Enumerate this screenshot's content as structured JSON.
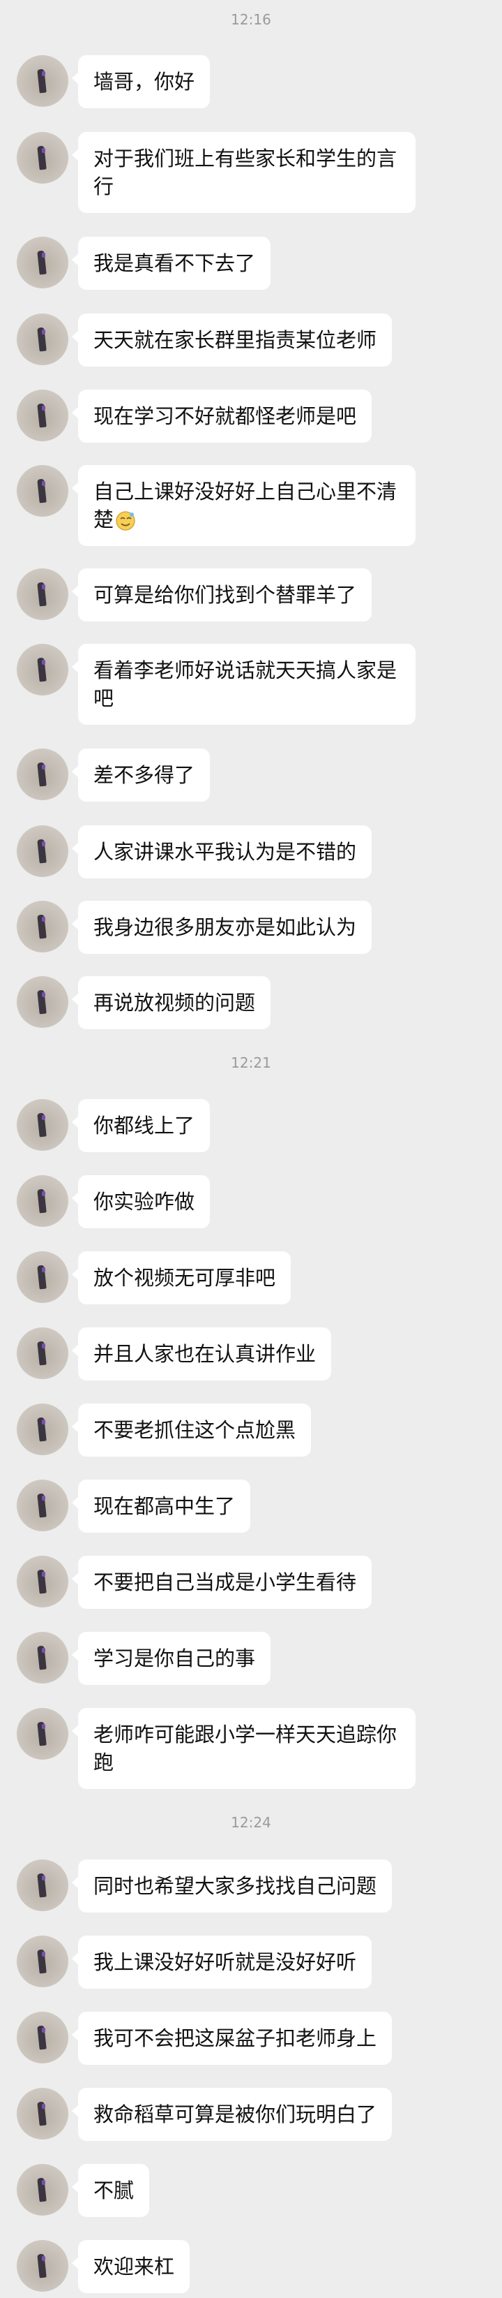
{
  "times": [
    "12:16",
    "12:21",
    "12:24"
  ],
  "messages": [
    {
      "text": "墙哥，你好"
    },
    {
      "text": "对于我们班上有些家长和学生的言行"
    },
    {
      "text": "我是真看不下去了"
    },
    {
      "text": "天天就在家长群里指责某位老师"
    },
    {
      "text": "现在学习不好就都怪老师是吧"
    },
    {
      "text": "自己上课好没好好上自己心里不清楚"
    },
    {
      "text": "可算是给你们找到个替罪羊了"
    },
    {
      "text": "看着李老师好说话就天天搞人家是吧"
    },
    {
      "text": "差不多得了"
    },
    {
      "text": "人家讲课水平我认为是不错的"
    },
    {
      "text": "我身边很多朋友亦是如此认为"
    },
    {
      "text": "再说放视频的问题"
    },
    {
      "text": "你都线上了"
    },
    {
      "text": "你实验咋做"
    },
    {
      "text": "放个视频无可厚非吧"
    },
    {
      "text": "并且人家也在认真讲作业"
    },
    {
      "text": "不要老抓住这个点尬黑"
    },
    {
      "text": "现在都高中生了"
    },
    {
      "text": "不要把自己当成是小学生看待"
    },
    {
      "text": "学习是你自己的事"
    },
    {
      "text": "老师咋可能跟小学一样天天追踪你跑"
    },
    {
      "text": "同时也希望大家多找找自己问题"
    },
    {
      "text": "我上课没好好听就是没好好听"
    },
    {
      "text": "我可不会把这屎盆子扣老师身上"
    },
    {
      "text": "救命稻草可算是被你们玩明白了"
    },
    {
      "text": "不腻"
    },
    {
      "text": "欢迎来杠"
    }
  ]
}
